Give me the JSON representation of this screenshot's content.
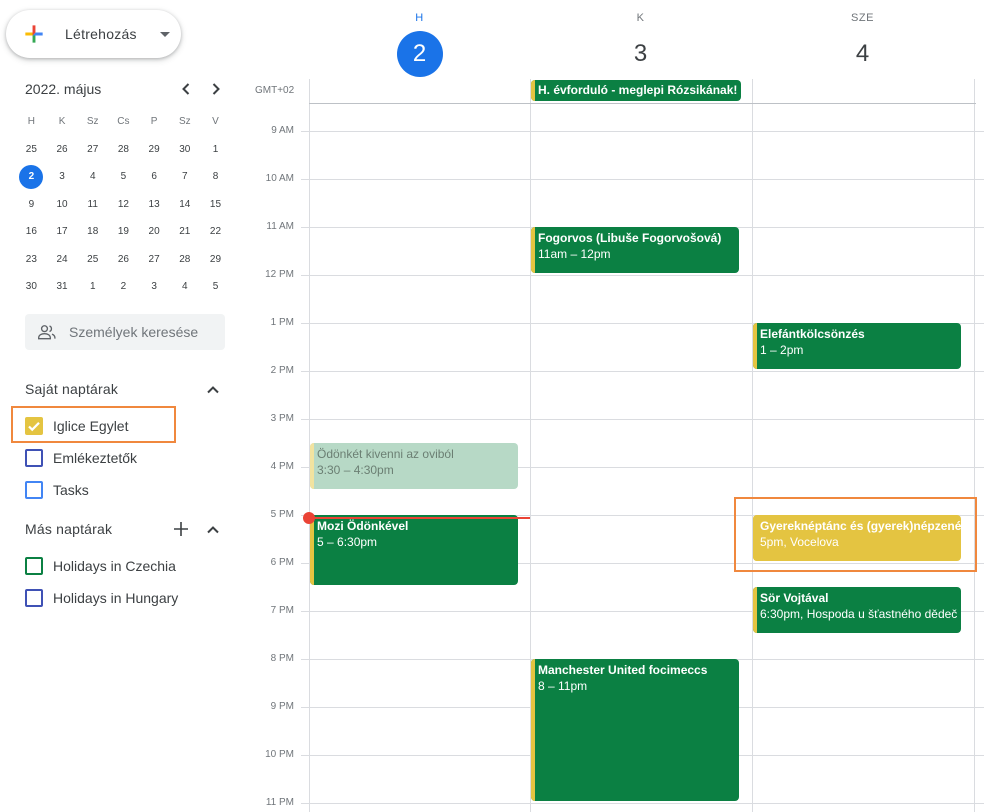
{
  "create_button": {
    "label": "Létrehozás"
  },
  "mini_calendar": {
    "title": "2022. május",
    "prev_icon": "chevron-left-icon",
    "next_icon": "chevron-right-icon",
    "weekdays": [
      "H",
      "K",
      "Sz",
      "Cs",
      "P",
      "Sz",
      "V"
    ],
    "weeks": [
      [
        "25",
        "26",
        "27",
        "28",
        "29",
        "30",
        "1"
      ],
      [
        "2",
        "3",
        "4",
        "5",
        "6",
        "7",
        "8"
      ],
      [
        "9",
        "10",
        "11",
        "12",
        "13",
        "14",
        "15"
      ],
      [
        "16",
        "17",
        "18",
        "19",
        "20",
        "21",
        "22"
      ],
      [
        "23",
        "24",
        "25",
        "26",
        "27",
        "28",
        "29"
      ],
      [
        "30",
        "31",
        "1",
        "2",
        "3",
        "4",
        "5"
      ]
    ],
    "today": "2"
  },
  "people_search": {
    "placeholder": "Személyek keresése"
  },
  "my_calendars": {
    "title": "Saját naptárak",
    "items": [
      {
        "name": "Iglice Egylet",
        "checked": true,
        "color": "#e4c441"
      },
      {
        "name": "Emlékeztetők",
        "checked": false,
        "color": "#3f51b5"
      },
      {
        "name": "Tasks",
        "checked": false,
        "color": "#4285f4"
      }
    ]
  },
  "other_calendars": {
    "title": "Más naptárak",
    "items": [
      {
        "name": "Holidays in Czechia",
        "checked": false,
        "color": "#0b8043"
      },
      {
        "name": "Holidays in Hungary",
        "checked": false,
        "color": "#3f51b5"
      }
    ]
  },
  "timezone": "GMT+02",
  "days": [
    {
      "dow": "H",
      "num": "2",
      "today": true
    },
    {
      "dow": "K",
      "num": "3",
      "today": false
    },
    {
      "dow": "SZE",
      "num": "4",
      "today": false
    }
  ],
  "hours": [
    "9 AM",
    "10 AM",
    "11 AM",
    "12 PM",
    "1 PM",
    "2 PM",
    "3 PM",
    "4 PM",
    "5 PM",
    "6 PM",
    "7 PM",
    "8 PM",
    "9 PM",
    "10 PM",
    "11 PM"
  ],
  "events": {
    "allday_tue": {
      "title": "H. évforduló - meglepi Rózsikának!"
    },
    "mon_1": {
      "title": "Ödönkét kivenni az oviból",
      "time": "3:30 – 4:30pm"
    },
    "mon_2": {
      "title": "Mozi Ödönkével",
      "time": "5 – 6:30pm"
    },
    "tue_1": {
      "title": "Fogorvos (Libuše Fogorvošová)",
      "time": "11am – 12pm"
    },
    "tue_2": {
      "title": "Manchester United focimeccs",
      "time": "8 – 11pm"
    },
    "wed_1": {
      "title": "Elefántkölcsönzés",
      "time": "1 – 2pm"
    },
    "wed_2": {
      "title": "Gyereknéptánc és (gyerek)népzenész",
      "time": "5pm, Vocelova"
    },
    "wed_3": {
      "title": "Sör Vojtával",
      "time": "6:30pm, Hospoda u šťastného dědeč"
    }
  },
  "colors": {
    "accent": "#1a73e8",
    "event_green": "#0b8043",
    "event_yellow": "#e4c441",
    "now_red": "#ea4335",
    "highlight": "#f0883e"
  }
}
